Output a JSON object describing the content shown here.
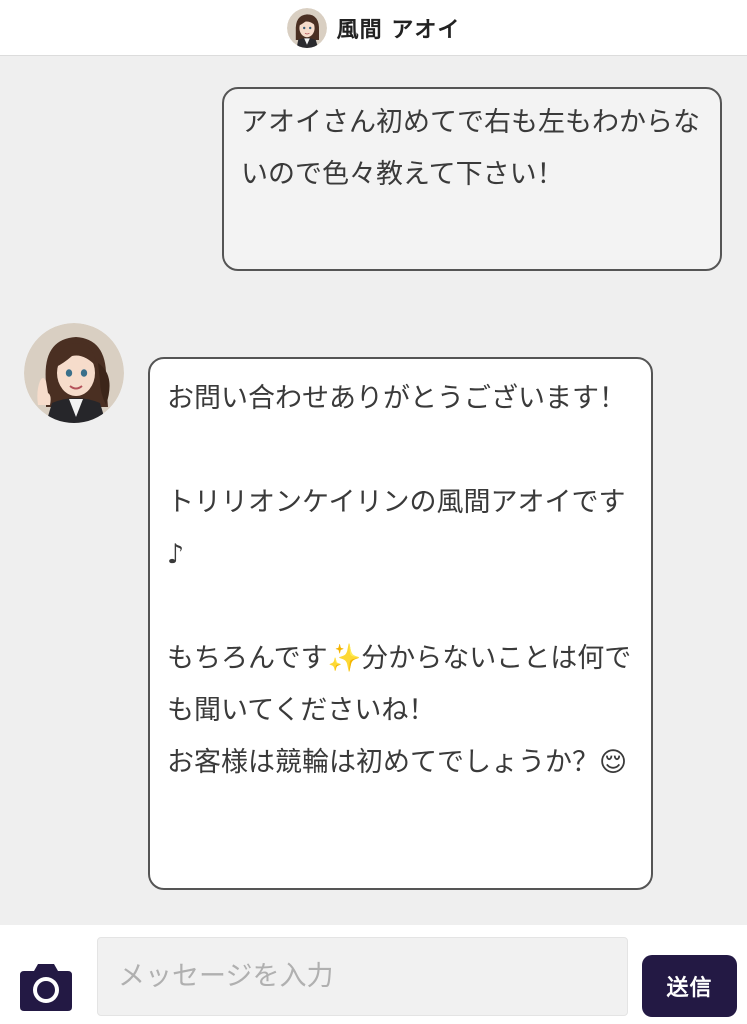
{
  "header": {
    "title": "風間 アオイ",
    "avatar_icon": "character-avatar-icon"
  },
  "messages": [
    {
      "sender": "user",
      "text": "アオイさん初めてで右も左もわからないので色々教えて下さい！"
    },
    {
      "sender": "bot",
      "avatar_icon": "character-avatar-icon",
      "text": "お問い合わせありがとうございます！\n\nトリリオンケイリンの風間アオイです♪\n\nもちろんです✨分からないことは何でも聞いてくださいね！\nお客様は競輪は初めてでしょうか？😌"
    }
  ],
  "composer": {
    "camera_icon": "camera-icon",
    "placeholder": "メッセージを入力",
    "value": "",
    "send_label": "送信"
  },
  "colors": {
    "background": "#efefef",
    "send_button": "#231944",
    "camera_icon": "#231944",
    "bubble_border": "#555555"
  }
}
